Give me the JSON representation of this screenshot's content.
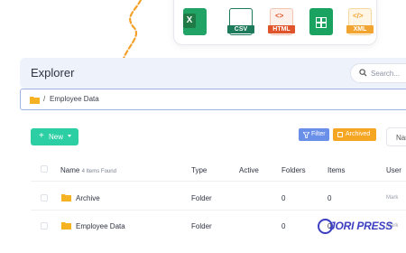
{
  "export_formats": [
    {
      "name": "excel-icon",
      "label": "X",
      "color": "#1f7a45"
    },
    {
      "name": "csv-icon",
      "label": "CSV",
      "color": "#1d7a5a"
    },
    {
      "name": "html-icon",
      "label": "HTML",
      "color": "#e0542b"
    },
    {
      "name": "sheets-icon",
      "label": "",
      "color": "#1aa260"
    },
    {
      "name": "xml-icon",
      "label": "XML",
      "color": "#f2a431"
    }
  ],
  "explorer": {
    "title": "Explorer",
    "search_placeholder": "Search..."
  },
  "breadcrumb": {
    "separator": "/",
    "path": "Employee Data"
  },
  "toolbar": {
    "new_label": "New",
    "filter_label": "Filter",
    "archived_label": "Archived",
    "right_label": "Nar"
  },
  "table": {
    "name_header": "Name",
    "items_found": "4 Items Found",
    "headers": {
      "type": "Type",
      "active": "Active",
      "folders": "Folders",
      "items": "Items",
      "user": "User"
    },
    "rows": [
      {
        "name": "Archive",
        "type": "Folder",
        "folders": "0",
        "items": "0",
        "user": "Mark"
      },
      {
        "name": "Employee Data",
        "type": "Folder",
        "folders": "0",
        "items": "0",
        "user": "Mark"
      }
    ]
  },
  "watermark": {
    "text": "JORI PRESS"
  },
  "colors": {
    "accent_green": "#2ccfa3",
    "filter_blue": "#6a8fe8",
    "archived_orange": "#f5a623",
    "folder_yellow": "#f5b324",
    "arrow_orange": "#f4a12a"
  }
}
